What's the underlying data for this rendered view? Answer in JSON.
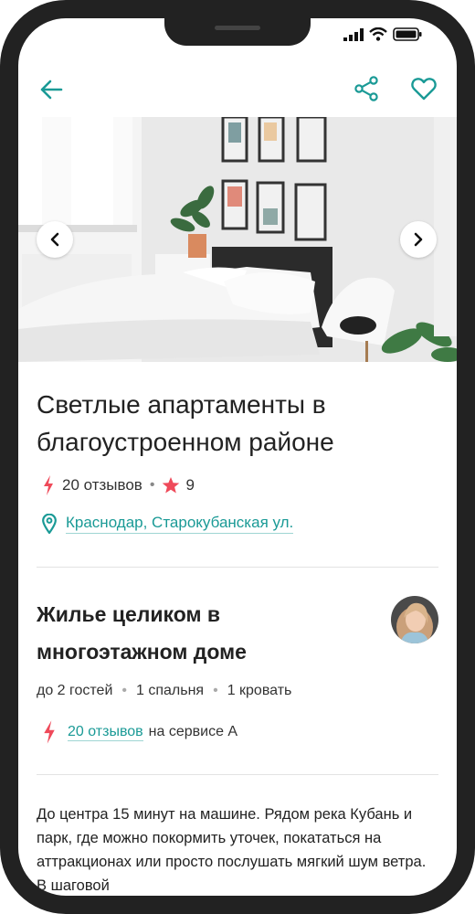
{
  "listing": {
    "title": "Светлые апартаменты в благоустроенном районе",
    "reviews_count": "20 отзывов",
    "rating": "9",
    "location": "Краснодар, Старокубанская ул."
  },
  "details": {
    "heading": "Жилье целиком в многоэтажном доме",
    "guests": "до 2 гостей",
    "bedrooms": "1 спальня",
    "beds": "1 кровать",
    "reviews_link": "20 отзывов",
    "reviews_source": "на сервисе А"
  },
  "description": "До центра 15 минут на машине. Рядом река Кубань и парк, где можно покормить уточек, покататься на аттракционах или просто послушать мягкий шум ветра. В шаговой",
  "icons": {
    "back": "arrow-left-icon",
    "share": "share-icon",
    "favorite": "heart-icon",
    "prev": "chevron-left-icon",
    "next": "chevron-right-icon",
    "reviews": "lightning-icon",
    "rating": "star-icon",
    "location": "map-pin-icon"
  },
  "colors": {
    "accent": "#1a9a96",
    "highlight": "#ef4a5a",
    "text": "#222222"
  }
}
